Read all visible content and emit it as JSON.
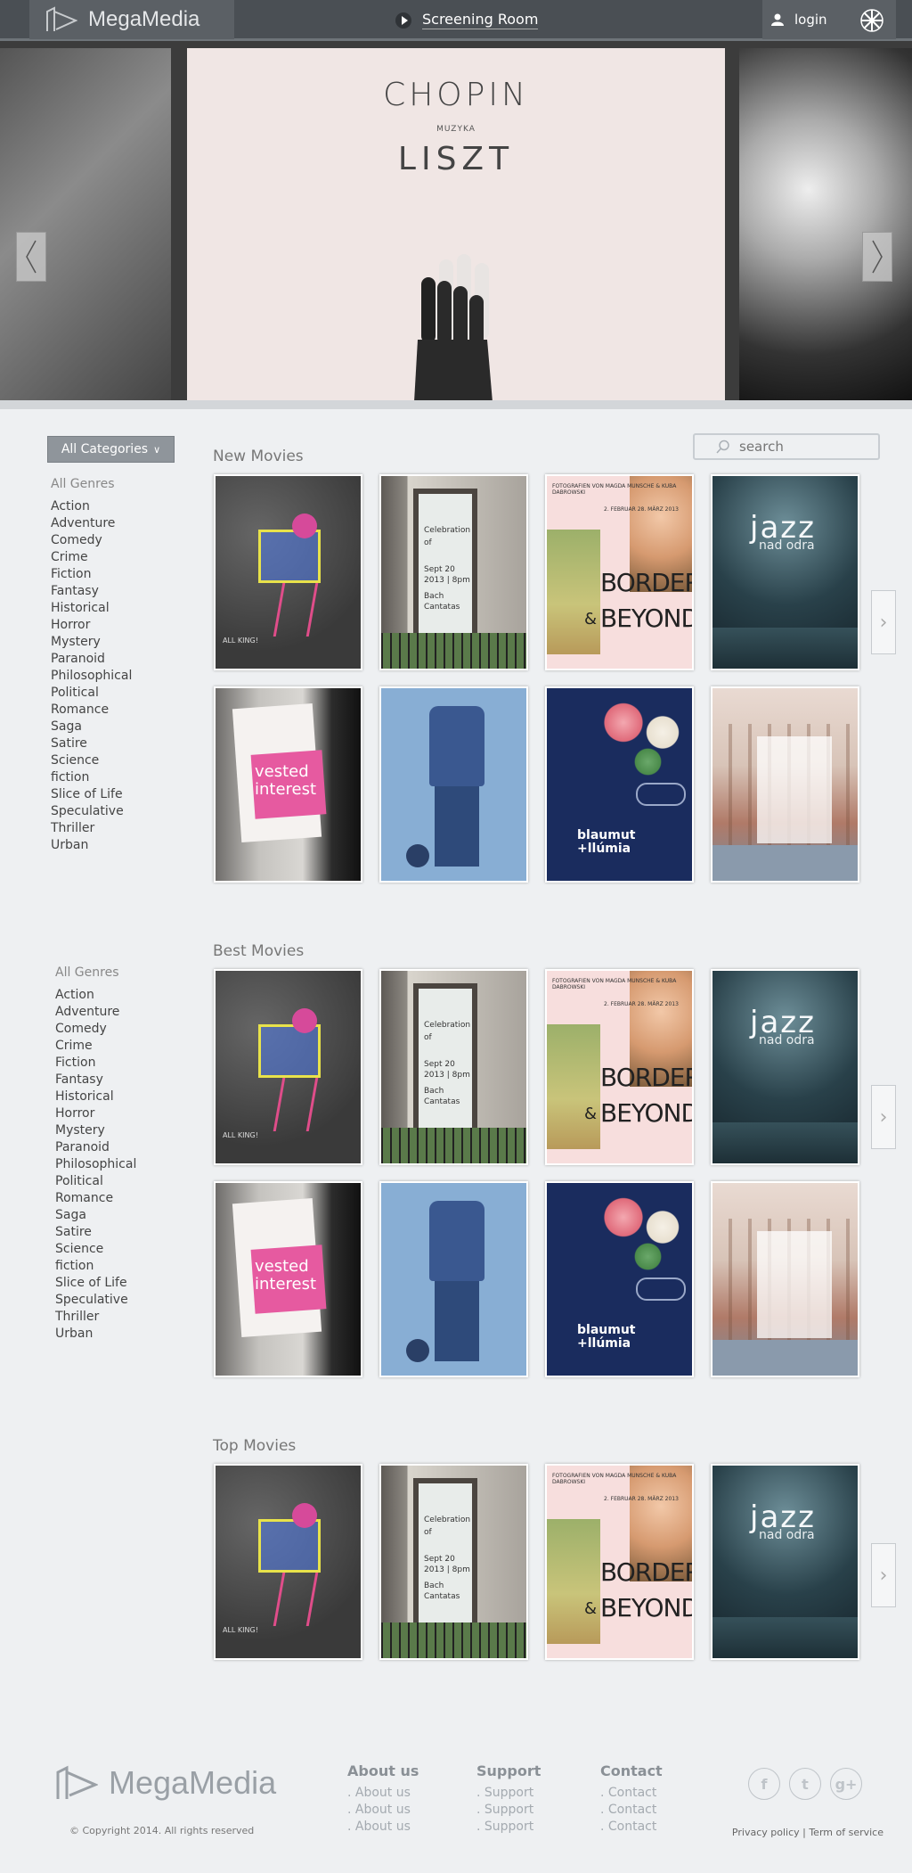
{
  "header": {
    "brand": "MegaMedia",
    "screening": "Screening Room",
    "login": "login"
  },
  "hero": {
    "line1": "CHOPIN",
    "line2": "MUZYKA",
    "line3": "LISZT"
  },
  "filters": {
    "categories_label": "All Categories",
    "search_placeholder": "search"
  },
  "genres": {
    "title": "All Genres",
    "items": [
      "Action",
      "Adventure",
      "Comedy",
      "Crime",
      "Fiction",
      "Fantasy",
      "Historical",
      "Horror",
      "Mystery",
      "Paranoid",
      "Philosophical",
      "Political",
      "Romance",
      "Saga",
      "Satire",
      "Science",
      "fiction",
      "Slice of Life",
      "Speculative",
      "Thriller",
      "Urban"
    ]
  },
  "sections": {
    "new": "New Movies",
    "best": "Best Movies",
    "top": "Top Movies"
  },
  "posters": {
    "chalk_caption": "ALL KING!",
    "celebration": "Celebration",
    "of": "of",
    "sept": "Sept 20",
    "time": "2013 | 8pm",
    "bach": "Bach",
    "cantatas": "Cantatas",
    "borders": "BORDERS",
    "amp": "&",
    "beyond": "BEYOND",
    "borders_credit": "FOTOGRAFIEN VON MAGDA MUNSCHE & KUBA DABROWSKI",
    "borders_date": "2. FEBRUAR 28. MÄRZ 2013",
    "jazz": "jazz",
    "jazz_sub": "nad odra",
    "vested": "vested",
    "interest": "interest",
    "blaumut": "blaumut",
    "llumia": "+llúmia"
  },
  "footer": {
    "brand": "MegaMedia",
    "col1_title": "About us",
    "col1_links": [
      ". About us",
      ". About us",
      ". About us"
    ],
    "col2_title": "Support",
    "col2_links": [
      ". Support",
      ". Support",
      ". Support"
    ],
    "col3_title": "Contact",
    "col3_links": [
      ". Contact",
      ". Contact",
      ". Contact"
    ],
    "social": [
      "f",
      "t",
      "g+"
    ],
    "copyright": "© Copyright 2014. All rights reserved",
    "policy": "Privacy policy | Term of service"
  }
}
